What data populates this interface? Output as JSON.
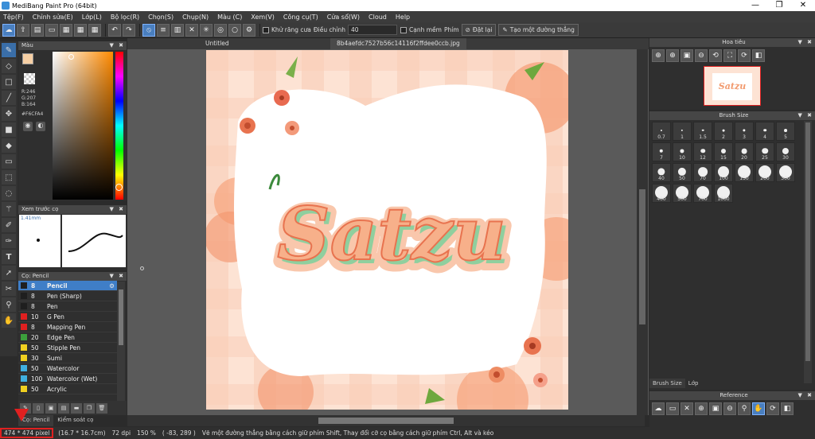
{
  "window": {
    "title": "MediBang Paint Pro (64bit)",
    "controls": [
      "—",
      "❐",
      "✕"
    ]
  },
  "menu": [
    "Tệp(F)",
    "Chỉnh sửa(E)",
    "Lớp(L)",
    "Bộ lọc(R)",
    "Chọn(S)",
    "Chụp(N)",
    "Màu (C)",
    "Xem(V)",
    "Công cụ(T)",
    "Cửa sổ(W)",
    "Cloud",
    "Help"
  ],
  "toolbar": {
    "antialias_label": "Khử răng cưa",
    "adjust_label": "Điều chỉnh",
    "adjust_value": "40",
    "smooth_label": "Cạnh mềm",
    "key_label": "Phím",
    "reset_label": "Đặt lại",
    "line_label": "Tạo một đường thẳng"
  },
  "color_panel": {
    "title": "Màu",
    "r": "R:246",
    "g": "G:207",
    "b": "B:164",
    "hex": "#F6CFA4",
    "fg": "#F6CFA4",
    "bg": "#E8642A"
  },
  "preview_panel": {
    "title": "Xem trước cọ",
    "size": "1.41mm"
  },
  "brush_panel": {
    "title": "Cọ: Pencil",
    "brushes": [
      {
        "size": "8",
        "name": "Pencil",
        "color": "#1f1f1f"
      },
      {
        "size": "8",
        "name": "Pen (Sharp)",
        "color": "#1f1f1f"
      },
      {
        "size": "8",
        "name": "Pen",
        "color": "#1f1f1f"
      },
      {
        "size": "10",
        "name": "G Pen",
        "color": "#e02020"
      },
      {
        "size": "8",
        "name": "Mapping Pen",
        "color": "#e02020"
      },
      {
        "size": "20",
        "name": "Edge Pen",
        "color": "#3ca03c"
      },
      {
        "size": "50",
        "name": "Stipple Pen",
        "color": "#f0d020"
      },
      {
        "size": "30",
        "name": "Sumi",
        "color": "#f0d020"
      },
      {
        "size": "50",
        "name": "Watercolor",
        "color": "#40b0e0"
      },
      {
        "size": "100",
        "name": "Watercolor (Wet)",
        "color": "#40b0e0"
      },
      {
        "size": "50",
        "name": "Acrylic",
        "color": "#f0d020"
      }
    ]
  },
  "bottom_tabs": [
    "Cọ: Pencil",
    "Kiểm soát cọ"
  ],
  "canvas": {
    "tabs": [
      "Untitled",
      "8b4aefdc7527b56c14116f2ffdee0ccb.jpg"
    ],
    "artwork_text": "Satzu"
  },
  "navigator": {
    "title": "Hoa tiêu"
  },
  "brush_size": {
    "title": "Brush Size",
    "sizes": [
      "0.7",
      "1",
      "1.5",
      "2",
      "3",
      "4",
      "5",
      "7",
      "10",
      "12",
      "15",
      "20",
      "25",
      "30",
      "40",
      "50",
      "70",
      "100",
      "150",
      "200",
      "300",
      "400",
      "500",
      "700",
      "1000"
    ],
    "tabs": [
      "Brush Size",
      "Lớp"
    ]
  },
  "reference": {
    "title": "Reference"
  },
  "status": {
    "dimensions": "474 * 474 pixel",
    "cm": "(16.7 * 16.7cm)",
    "dpi": "72 dpi",
    "zoom": "150 %",
    "coords": "( -83, 289 )",
    "hint": "Vẽ một đường thẳng bằng cách giữ phím Shift, Thay đổi cỡ cọ bằng cách giữ phím Ctrl, Alt và kéo"
  }
}
